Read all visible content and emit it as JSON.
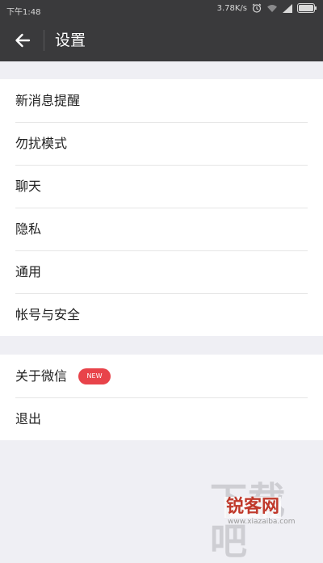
{
  "status_bar": {
    "carrier": "下午1:48",
    "speed": "3.78K/s",
    "icons": [
      "alarm-icon",
      "wifi-icon",
      "signal-icon",
      "battery-icon"
    ]
  },
  "app_bar": {
    "back_icon": "arrow-left-icon",
    "title": "设置"
  },
  "settings": {
    "group1": [
      {
        "label": "新消息提醒"
      },
      {
        "label": "勿扰模式"
      },
      {
        "label": "聊天"
      },
      {
        "label": "隐私"
      },
      {
        "label": "通用"
      },
      {
        "label": "帐号与安全"
      }
    ],
    "group2": [
      {
        "label": "关于微信",
        "badge": "NEW"
      },
      {
        "label": "退出"
      }
    ]
  },
  "watermark": {
    "big": "下载吧",
    "brand": "锐客网",
    "url": "www.xiazaiba.com"
  },
  "colors": {
    "toolbar": "#3a3a3c",
    "background": "#efeff4",
    "badge": "#e8434a"
  }
}
